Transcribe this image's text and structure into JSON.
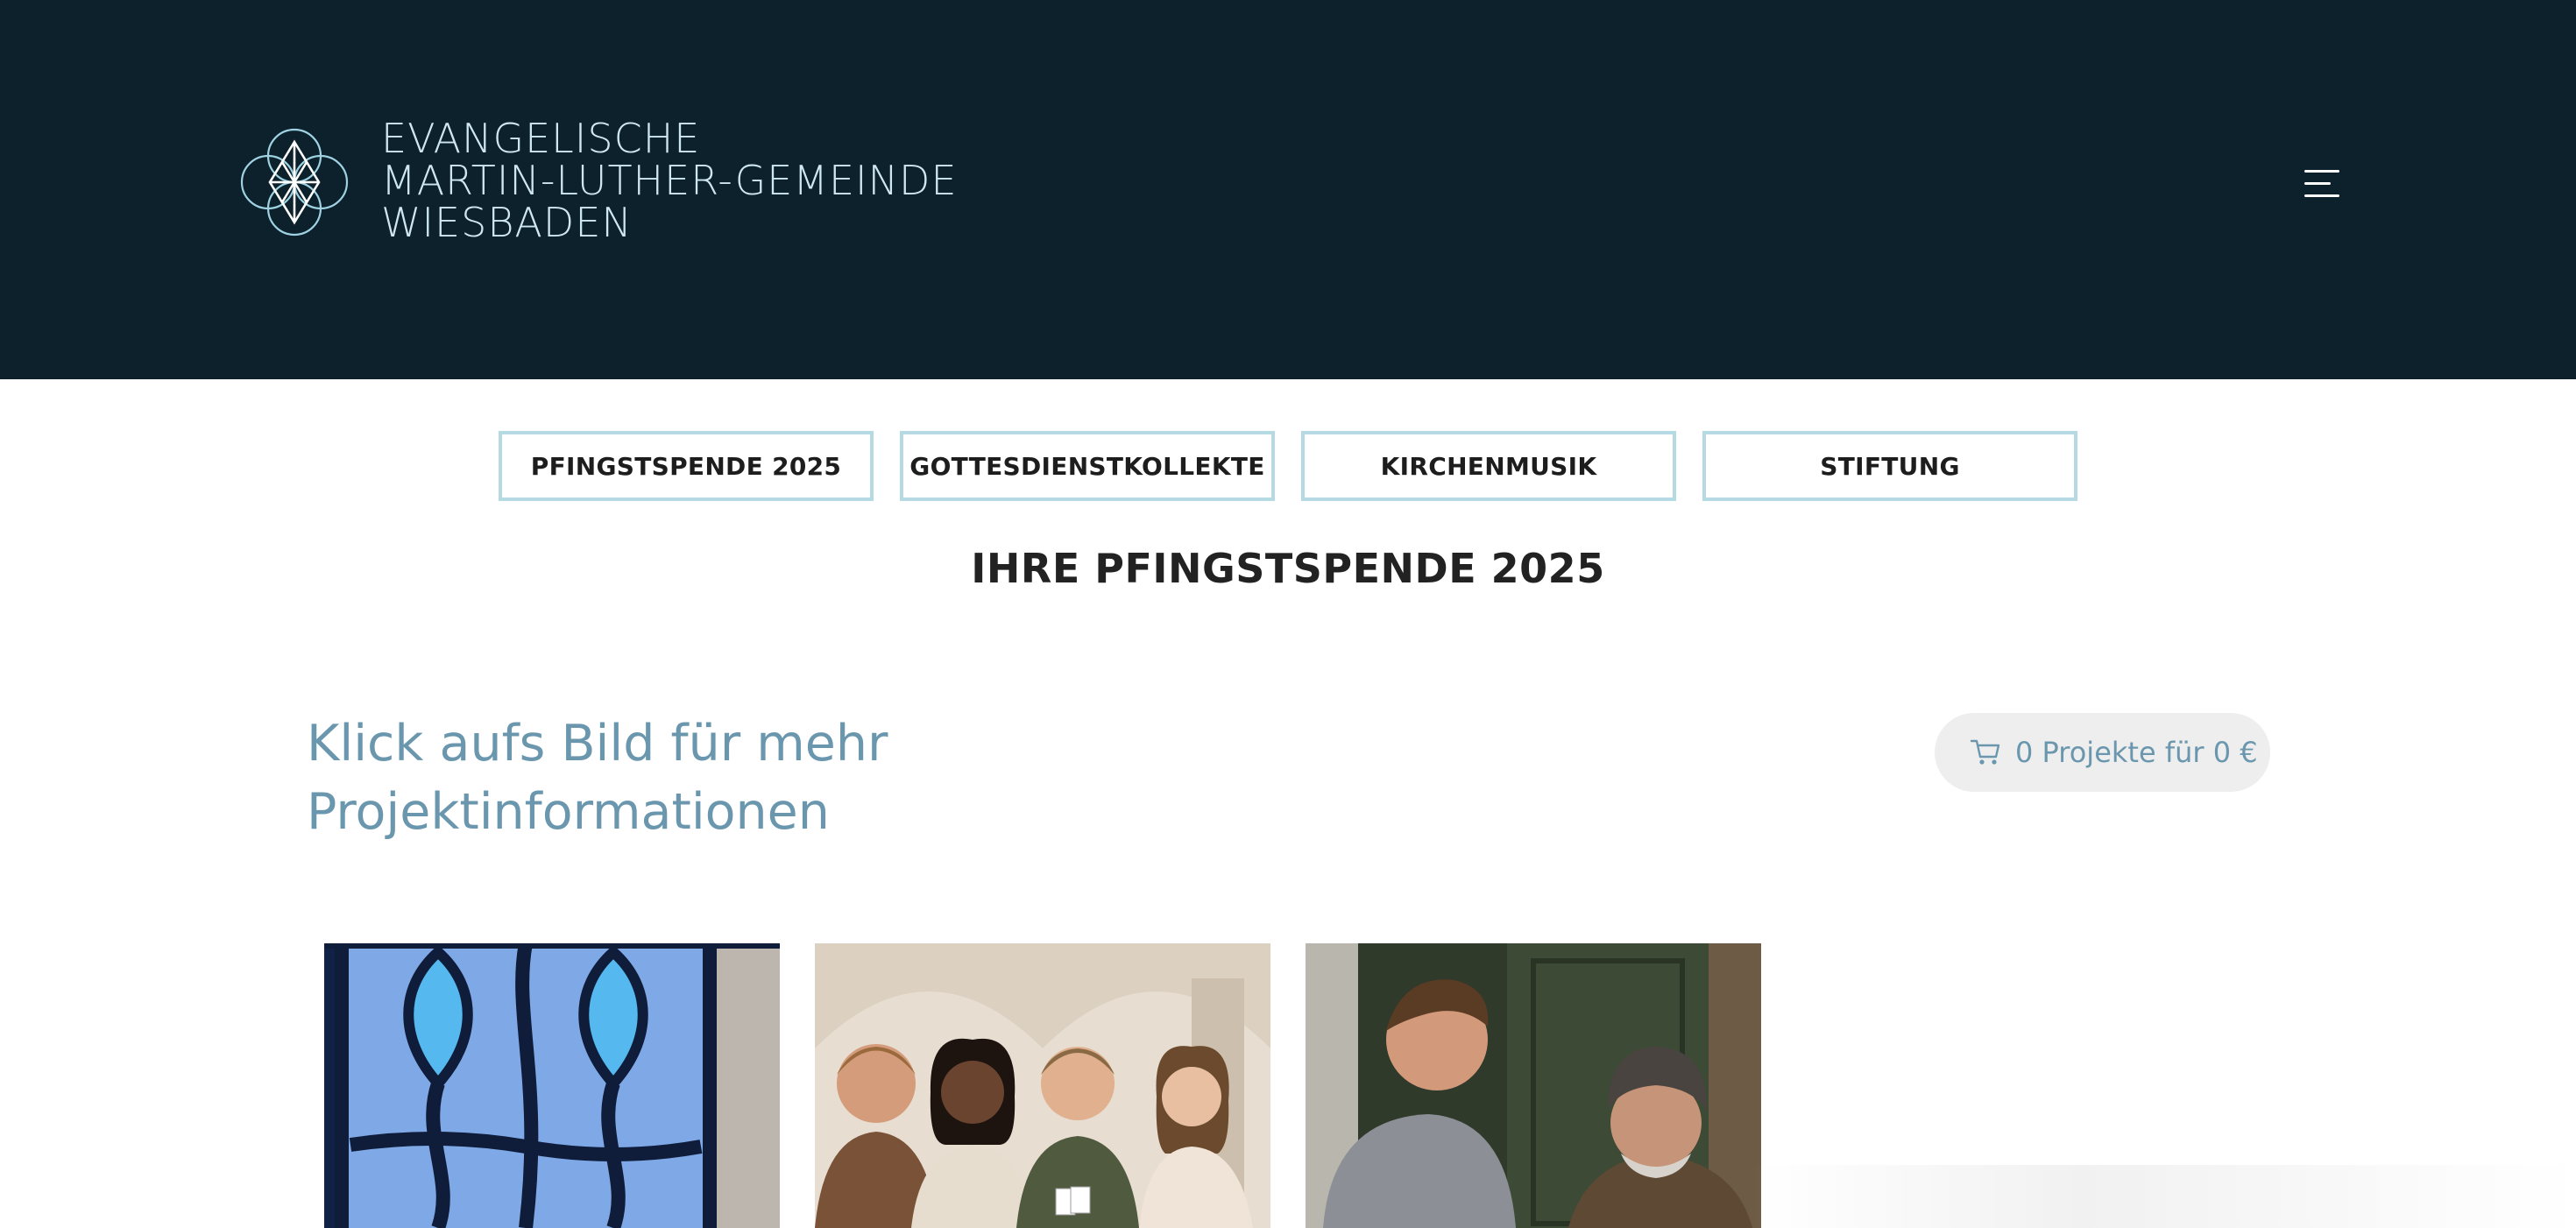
{
  "header": {
    "logo_lines": [
      "EVANGELISCHE",
      "MARTIN-LUTHER-GEMEINDE",
      "WIESBADEN"
    ],
    "menu_icon": "hamburger-menu-icon",
    "background_color": "#0c212c"
  },
  "tabs": [
    {
      "label": "PFINGSTSPENDE 2025"
    },
    {
      "label": "GOTTESDIENSTKOLLEKTE"
    },
    {
      "label": "KIRCHENMUSIK"
    },
    {
      "label": "STIFTUNG"
    }
  ],
  "main": {
    "title": "IHRE PFINGSTSPENDE 2025",
    "intro_line1": "Klick aufs Bild für mehr",
    "intro_line2": "Projektinformationen",
    "cart_label": "0 Projekte für 0 €",
    "cart_icon": "shopping-cart-icon",
    "accent_color": "#6b97ae"
  },
  "projects": [
    {
      "image": "stained-glass-window-image"
    },
    {
      "image": "youth-group-playing-cards-image"
    },
    {
      "image": "young-man-helping-elderly-man-image"
    }
  ]
}
